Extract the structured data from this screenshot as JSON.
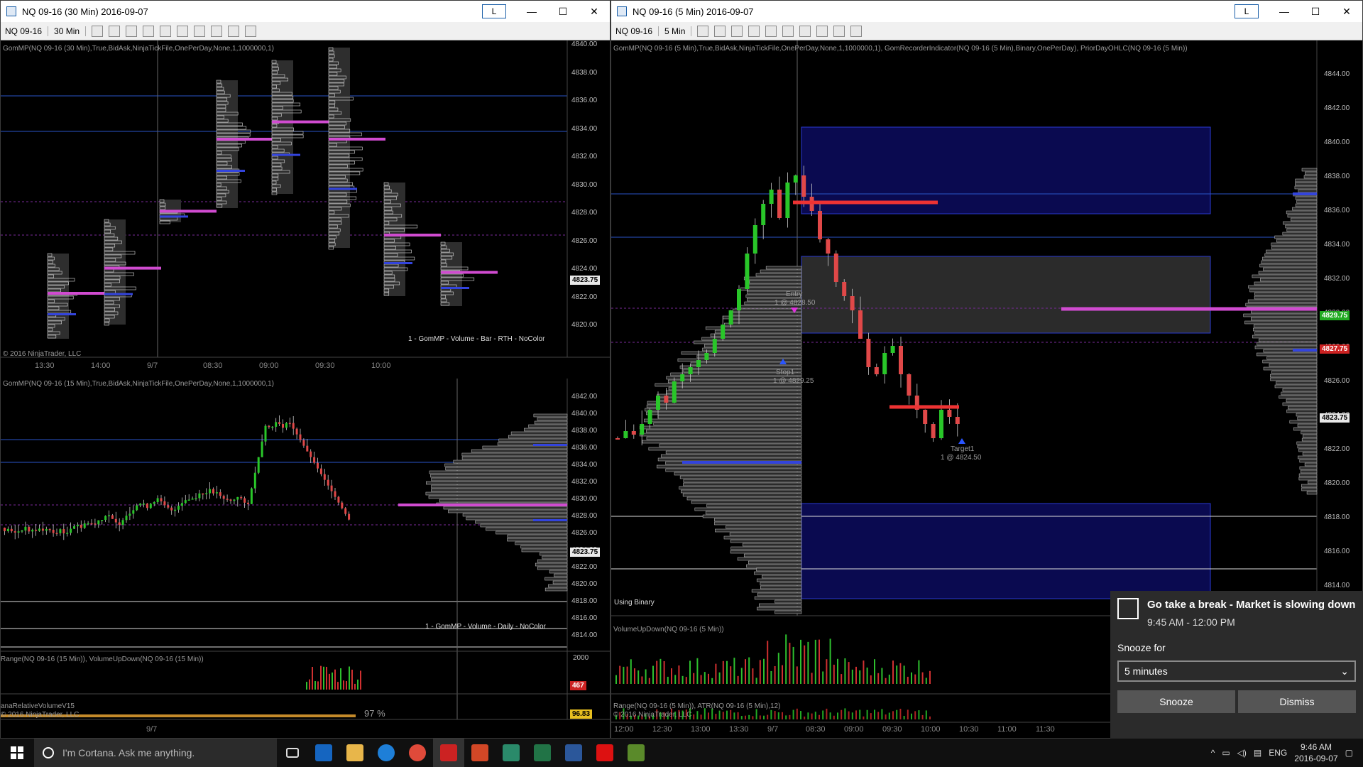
{
  "left_window": {
    "title": "NQ 09-16 (30 Min)  2016-09-07",
    "toolbar": {
      "instrument": "NQ 09-16",
      "interval": "30 Min"
    },
    "link_button": "L",
    "top_pane": {
      "indicator_label": "GomMP(NQ 09-16 (30 Min),True,BidAsk,NinjaTickFile,OnePerDay,None,1,1000000,1)",
      "copyright": "© 2016 NinjaTrader, LLC",
      "legend": "1 - GomMP - Volume - Bar - RTH - NoColor",
      "price_labels": [
        "4840.00",
        "4838.00",
        "4836.00",
        "4834.00",
        "4832.00",
        "4830.00",
        "4828.00",
        "4826.00",
        "4824.00",
        "4822.00",
        "4820.00"
      ],
      "current_price": "4823.75",
      "time_labels": [
        "13:30",
        "14:00",
        "9/7",
        "08:30",
        "09:00",
        "09:30",
        "10:00"
      ]
    },
    "bottom_pane": {
      "indicator_label": "GomMP(NQ 09-16 (15 Min),True,BidAsk,NinjaTickFile,OnePerDay,None,1,1000000,1)",
      "legend": "1 - GomMP - Volume - Daily - NoColor",
      "price_labels": [
        "4842.00",
        "4840.00",
        "4838.00",
        "4836.00",
        "4834.00",
        "4832.00",
        "4830.00",
        "4828.00",
        "4826.00",
        "4824.00",
        "4822.00",
        "4820.00",
        "4818.00",
        "4816.00",
        "4814.00"
      ],
      "current_price": "4823.75",
      "range_label": "Range(NQ 09-16 (15 Min)), VolumeUpDown(NQ 09-16 (15 Min))",
      "range_value": "467",
      "range_axis": "2000",
      "rv_label": "anaRelativeVolumeV15",
      "rv_copyright": "© 2016 NinjaTrader, LLC",
      "rv_pct": "97 %",
      "rv_value": "96.83",
      "time_labels": [
        "9/7"
      ]
    }
  },
  "right_window": {
    "title": "NQ 09-16 (5 Min)  2016-09-07",
    "toolbar": {
      "instrument": "NQ 09-16",
      "interval": "5 Min"
    },
    "link_button": "L",
    "indicator_label": "GomMP(NQ 09-16 (5 Min),True,BidAsk,NinjaTickFile,OnePerDay,None,1,1000000,1), GomRecorderIndicator(NQ 09-16 (5 Min),Binary,OnePerDay), PriorDayOHLC(NQ 09-16 (5 Min))",
    "using_binary": "Using Binary",
    "price_labels": [
      "4844.00",
      "4842.00",
      "4840.00",
      "4838.00",
      "4836.00",
      "4834.00",
      "4832.00",
      "4830.00",
      "4828.00",
      "4826.00",
      "4824.00",
      "4822.00",
      "4820.00",
      "4818.00",
      "4816.00",
      "4814.00"
    ],
    "marker_prices": {
      "green": "4829.75",
      "red": "4827.75",
      "current": "4823.75"
    },
    "entry_label": "Entry",
    "entry_fill": "1 @ 4828.50",
    "stop_label": "Stop1",
    "stop_fill": "1 @ 4829.25",
    "target_label": "Target1",
    "target_fill": "1 @ 4824.50",
    "vol_label": "VolumeUpDown(NQ 09-16 (5 Min))",
    "range_label": "Range(NQ 09-16 (5 Min)), ATR(NQ 09-16 (5 Min),12)",
    "copyright": "© 2016 NinjaTrader, LLC",
    "time_labels": [
      "12:00",
      "12:30",
      "13:00",
      "13:30",
      "9/7",
      "08:30",
      "09:00",
      "09:30",
      "10:00",
      "10:30",
      "11:00",
      "11:30"
    ]
  },
  "toast": {
    "title": "Go take a break - Market is slowing down",
    "time": "9:45 AM - 12:00 PM",
    "snooze_label": "Snooze for",
    "snooze_value": "5 minutes",
    "snooze_button": "Snooze",
    "dismiss_button": "Dismiss"
  },
  "taskbar": {
    "search_placeholder": "I'm Cortana. Ask me anything.",
    "language": "ENG",
    "time": "9:46 AM",
    "date": "2016-09-07",
    "apps": [
      "outlook-icon",
      "file-explorer-icon",
      "edge-icon",
      "chrome-icon",
      "ninjatrader-icon",
      "powerpoint-icon",
      "tws-icon",
      "excel-icon",
      "word-icon",
      "adobe-icon",
      "app-icon"
    ]
  },
  "colors": {
    "accent_blue": "#1b5fa8",
    "poc_magenta": "#d04bd0",
    "value_blue": "#3344dd",
    "up_green": "#29c629",
    "down_red": "#e04848"
  }
}
